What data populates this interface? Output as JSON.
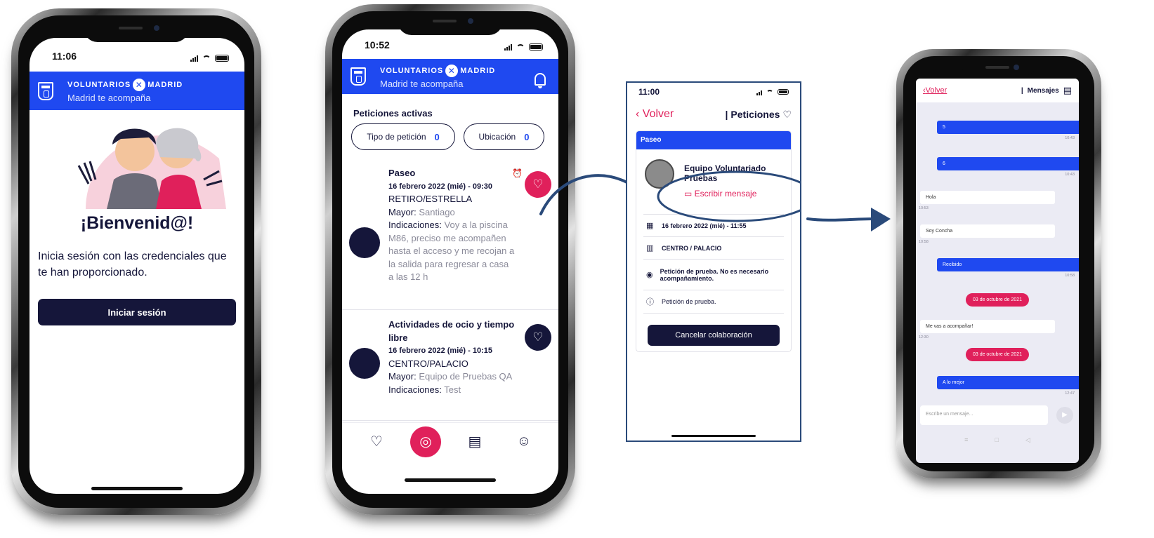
{
  "phone1": {
    "status_time": "11:06",
    "brand": {
      "left": "VOLUNTARIOS",
      "right": "MADRID"
    },
    "tagline": "Madrid te acompaña",
    "welcome_title": "¡Bienvenid@!",
    "welcome_text": "Inicia sesión con las credenciales que te han proporcionado.",
    "login_button": "Iniciar sesión"
  },
  "phone2": {
    "status_time": "10:52",
    "brand": {
      "left": "VOLUNTARIOS",
      "right": "MADRID"
    },
    "tagline": "Madrid te acompaña",
    "section_title": "Peticiones activas",
    "filters": [
      {
        "label": "Tipo de petición",
        "count": "0"
      },
      {
        "label": "Ubicación",
        "count": "0"
      }
    ],
    "requests": [
      {
        "title": "Paseo",
        "date": "16 febrero 2022 (mié) - 09:30",
        "zone": "RETIRO/ESTRELLA",
        "elder_label": "Mayor:",
        "elder": "Santiago",
        "indications_label": "Indicaciones:",
        "indications": "Voy a la piscina M86, preciso me acompañen hasta el acceso y me recojan a la salida para regresar a casa a las 12 h"
      },
      {
        "title": "Actividades de ocio y tiempo libre",
        "date": "16 febrero 2022 (mié) - 10:15",
        "zone": "CENTRO/PALACIO",
        "elder_label": "Mayor:",
        "elder": "Equipo de Pruebas QA",
        "indications_label": "Indicaciones:",
        "indications": "Test"
      }
    ]
  },
  "screen3": {
    "status_time": "11:00",
    "back_label": "Volver",
    "nav_title": "Peticiones",
    "card_header": "Paseo",
    "volunteer_name": "Equipo Voluntariado Pruebas",
    "write_message": "Escribir mensaje",
    "date": "16 febrero 2022 (mié) - 11:55",
    "location": "CENTRO / PALACIO",
    "description": "Petición de prueba. No es necesario acompañamiento.",
    "note": "Petición de prueba.",
    "cancel_button": "Cancelar colaboración"
  },
  "phone4": {
    "back_label": "Volver",
    "title": "Mensajes",
    "messages": [
      {
        "dir": "out",
        "text": "5",
        "time": "10:43"
      },
      {
        "dir": "out",
        "text": "6",
        "time": "10:43"
      },
      {
        "dir": "in",
        "text": "Hola",
        "time": "10:53"
      },
      {
        "dir": "in",
        "text": "Soy Concha",
        "time": "10:58"
      },
      {
        "dir": "out",
        "text": "Recibido",
        "time": "10:58"
      },
      {
        "dir": "date",
        "text": "03 de octubre de 2021"
      },
      {
        "dir": "in",
        "text": "Me vas a acompañar!",
        "time": "12:30"
      },
      {
        "dir": "date",
        "text": "03 de octubre de 2021"
      },
      {
        "dir": "out",
        "text": "A lo mejor",
        "time": "12:47"
      }
    ],
    "input_placeholder": "Escribe un mensaje..."
  },
  "colors": {
    "brand_blue": "#1f49f0",
    "accent_pink": "#e0205b",
    "navy": "#15163a",
    "annotation_blue": "#2a4a7a"
  },
  "icons": [
    "madrid-crest-icon",
    "bell-icon",
    "heart-icon",
    "heart-plus-icon",
    "alarm-icon",
    "radar-icon",
    "chat-icon",
    "elder-face-icon",
    "chevron-left-icon",
    "message-icon",
    "calendar-icon",
    "map-icon",
    "location-pin-icon",
    "info-icon",
    "send-icon"
  ]
}
